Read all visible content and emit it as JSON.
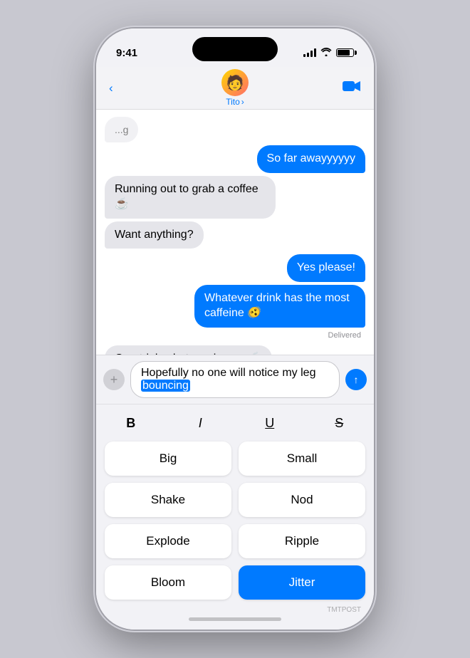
{
  "statusBar": {
    "time": "9:41",
    "batteryLevel": "80%"
  },
  "navBar": {
    "backLabel": "‹",
    "contactName": "Tito",
    "contactChevron": "›",
    "videoCallIcon": "📹"
  },
  "messages": [
    {
      "id": 1,
      "type": "received",
      "text": "...g",
      "partial": true
    },
    {
      "id": 2,
      "type": "sent",
      "text": "So far awayyyyyy"
    },
    {
      "id": 3,
      "type": "received",
      "text": "Running out to grab a coffee ☕"
    },
    {
      "id": 4,
      "type": "received",
      "text": "Want anything?"
    },
    {
      "id": 5,
      "type": "sent",
      "text": "Yes please!"
    },
    {
      "id": 6,
      "type": "sent",
      "text": "Whatever drink has the most caffeine 🫨"
    },
    {
      "id": 7,
      "type": "delivered",
      "text": "Delivered"
    },
    {
      "id": 8,
      "type": "received",
      "text": "One triple shot coming up ☕"
    }
  ],
  "inputArea": {
    "plusIcon": "+",
    "inputText": "Hopefully no one will notice my leg ",
    "highlightedText": "bouncing",
    "sendIcon": "↑"
  },
  "formatToolbar": {
    "bold": "B",
    "italic": "I",
    "underline": "U",
    "strikethrough": "S"
  },
  "effectsGrid": [
    {
      "id": 1,
      "label": "Big",
      "active": false
    },
    {
      "id": 2,
      "label": "Small",
      "active": false
    },
    {
      "id": 3,
      "label": "Shake",
      "active": false
    },
    {
      "id": 4,
      "label": "Nod",
      "active": false
    },
    {
      "id": 5,
      "label": "Explode",
      "active": false
    },
    {
      "id": 6,
      "label": "Ripple",
      "active": false
    },
    {
      "id": 7,
      "label": "Bloom",
      "active": false
    },
    {
      "id": 8,
      "label": "Jitter",
      "active": true
    }
  ],
  "watermark": "TMTPOST"
}
